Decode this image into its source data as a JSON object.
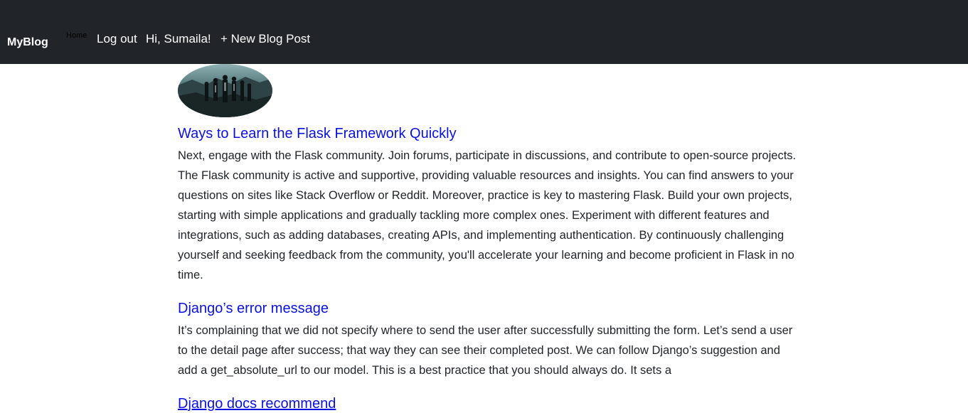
{
  "nav": {
    "brand": "MyBlog",
    "home": "Home",
    "logout": "Log out",
    "greeting": "Hi, Sumaila!",
    "new_post": "+ New Blog Post"
  },
  "posts": [
    {
      "title": "Ways to Learn the Flask Framework Quickly",
      "excerpt": "Next, engage with the Flask community. Join forums, participate in discussions, and contribute to open-source projects. The Flask community is active and supportive, providing valuable resources and insights. You can find answers to your questions on sites like Stack Overflow or Reddit. Moreover, practice is key to mastering Flask. Build your own projects, starting with simple applications and gradually tackling more complex ones. Experiment with different features and integrations, such as adding databases, creating APIs, and implementing authentication. By continuously challenging yourself and seeking feedback from the community, you'll accelerate your learning and become proficient in Flask in no time."
    },
    {
      "title": "Django’s error message",
      "excerpt": "It’s complaining that we did not specify where to send the user after successfully submitting the form. Let’s send a user to the detail page after success; that way they can see their completed post. We can follow Django’s suggestion and add a get_absolute_url to our model. This is a best practice that you should always do. It sets a"
    },
    {
      "title": "Django docs recommend",
      "excerpt": ""
    }
  ],
  "colors": {
    "navbar_bg": "#212529",
    "link": "#0a11e0",
    "text": "#212529"
  },
  "icons": {
    "thumbnail": "post-thumbnail-image"
  }
}
